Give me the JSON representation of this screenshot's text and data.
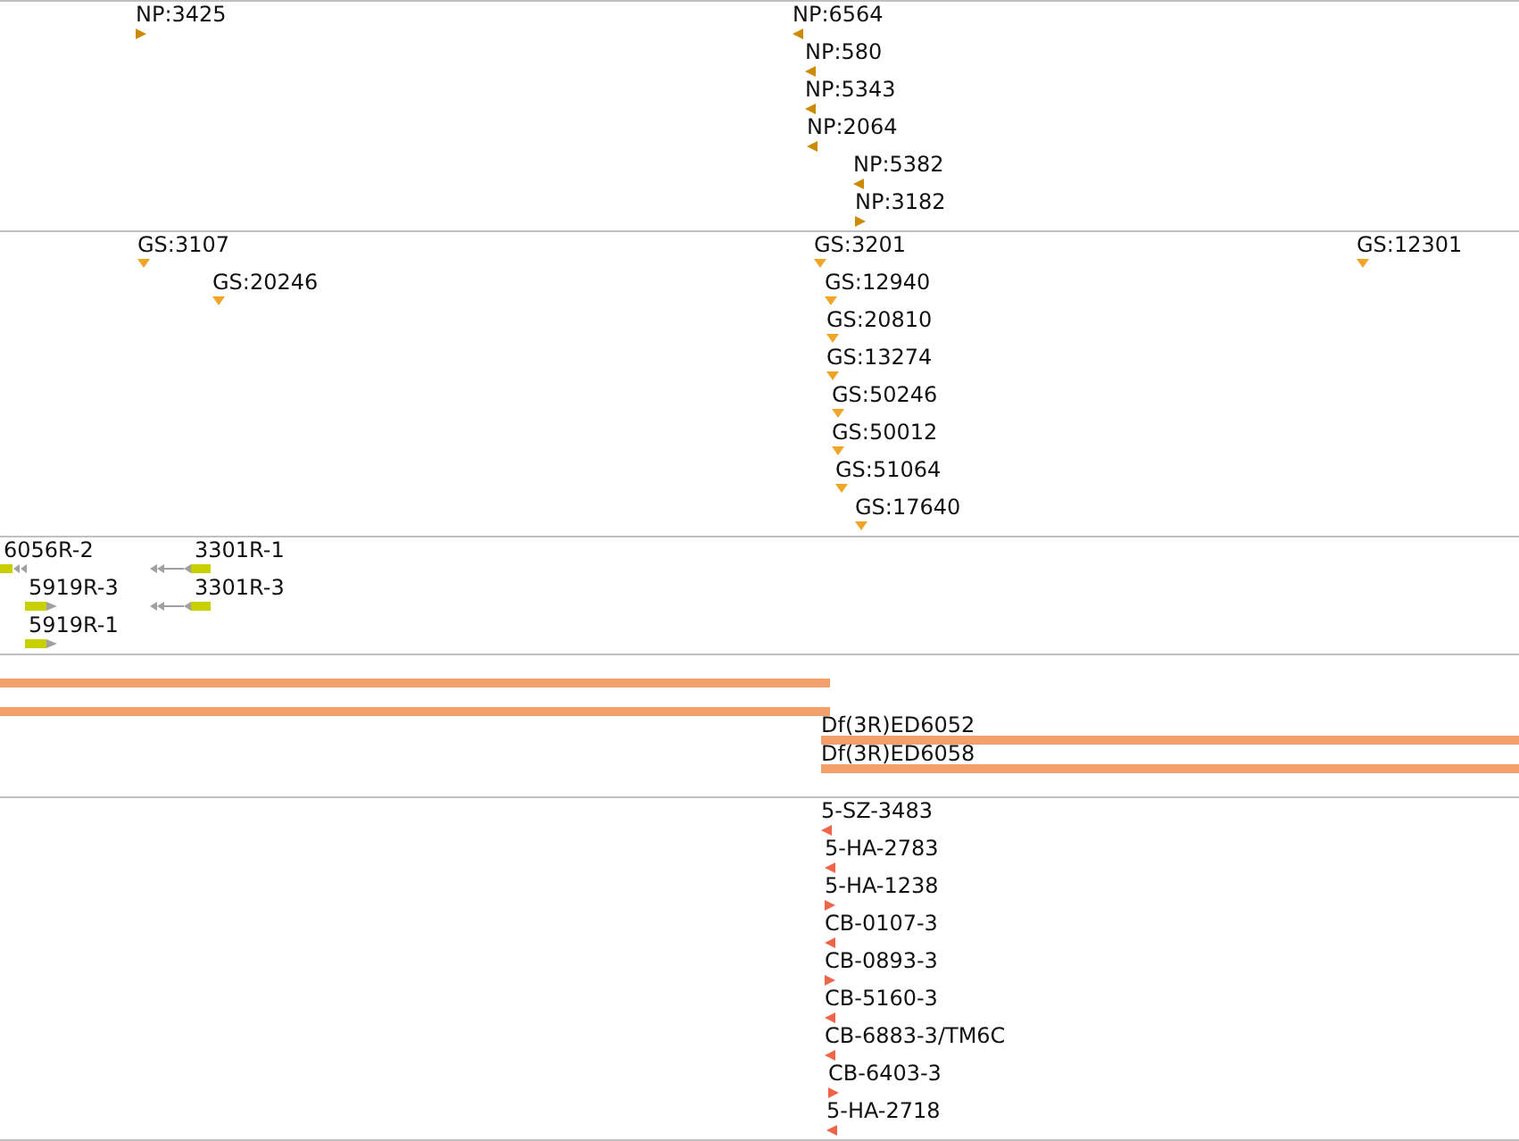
{
  "tracks": [
    {
      "kind": "stranded",
      "color": "#cc8a00",
      "rows": [
        [
          {
            "label": "NP:3425",
            "reverse": false
          },
          {
            "label": "NP:6564",
            "reverse": true
          }
        ],
        [
          {
            "label": "NP:580",
            "reverse": true
          }
        ],
        [
          {
            "label": "NP:5343",
            "reverse": true
          }
        ],
        [
          {
            "label": "NP:2064",
            "reverse": true
          }
        ],
        [
          {
            "label": "NP:5382",
            "reverse": true
          }
        ],
        [
          {
            "label": "NP:3182",
            "reverse": false
          }
        ]
      ]
    },
    {
      "kind": "sites",
      "color": "#f0a428",
      "rows": [
        [
          {
            "label": "GS:3107"
          },
          {
            "label": "GS:3201"
          },
          {
            "label": "GS:12301"
          }
        ],
        [
          {
            "label": "GS:20246"
          },
          {
            "label": "GS:12940"
          }
        ],
        [
          {
            "label": "GS:20810"
          }
        ],
        [
          {
            "label": "GS:13274"
          }
        ],
        [
          {
            "label": "GS:50246"
          }
        ],
        [
          {
            "label": "GS:50012"
          }
        ],
        [
          {
            "label": "GS:51064"
          }
        ],
        [
          {
            "label": "GS:17640"
          }
        ]
      ]
    },
    {
      "kind": "constructs",
      "rows": [
        [
          {
            "label": "6056R-2",
            "reverse": true
          },
          {
            "label": "3301R-1",
            "reverse": true
          }
        ],
        [
          {
            "label": "5919R-3",
            "reverse": false
          },
          {
            "label": "3301R-3",
            "reverse": true
          }
        ],
        [
          {
            "label": "5919R-1",
            "reverse": false
          }
        ]
      ]
    },
    {
      "kind": "ranges",
      "color": "#f4a06c",
      "rows": [
        [
          {}
        ],
        [
          {}
        ],
        [
          {
            "label": "Df(3R)ED6052"
          }
        ],
        [
          {
            "label": "Df(3R)ED6058"
          }
        ]
      ]
    },
    {
      "kind": "stranded",
      "color": "#f06448",
      "rows": [
        [
          {
            "label": "5-SZ-3483",
            "reverse": true
          }
        ],
        [
          {
            "label": "5-HA-2783",
            "reverse": true
          }
        ],
        [
          {
            "label": "5-HA-1238",
            "reverse": false
          }
        ],
        [
          {
            "label": "CB-0107-3",
            "reverse": true
          }
        ],
        [
          {
            "label": "CB-0893-3",
            "reverse": false
          }
        ],
        [
          {
            "label": "CB-5160-3",
            "reverse": true
          }
        ],
        [
          {
            "label": "CB-6883-3/TM6C",
            "reverse": true
          }
        ],
        [
          {
            "label": "CB-6403-3",
            "reverse": false
          }
        ],
        [
          {
            "label": "5-HA-2718",
            "reverse": true
          }
        ]
      ]
    }
  ]
}
